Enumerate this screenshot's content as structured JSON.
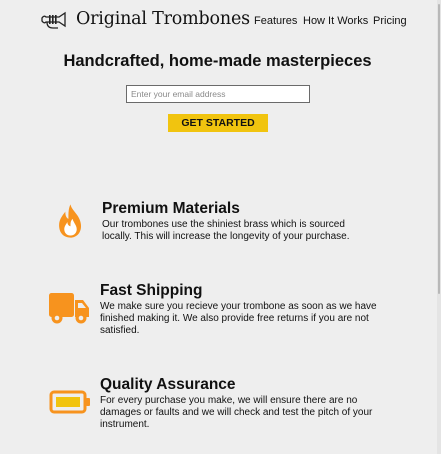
{
  "header": {
    "logo_icon": "trumpet-icon",
    "brand": "Original Trombones",
    "nav": [
      "Features",
      "How It Works",
      "Pricing"
    ]
  },
  "hero": {
    "title": "Handcrafted, home-made masterpieces",
    "email_placeholder": "Enter your email address",
    "cta_label": "GET STARTED"
  },
  "features": [
    {
      "icon": "fire-icon",
      "title": "Premium Materials",
      "description": "Our trombones use the shiniest brass which is sourced locally. This will increase the longevity of your purchase."
    },
    {
      "icon": "truck-icon",
      "title": "Fast Shipping",
      "description": "We make sure you recieve your trombone as soon as we have finished making it. We also provide free returns if you are not satisfied."
    },
    {
      "icon": "battery-icon",
      "title": "Quality Assurance",
      "description": "For every purchase you make, we will ensure there are no damages or faults and we will check and test the pitch of your instrument."
    }
  ],
  "colors": {
    "accent": "#f1c40f",
    "icon_orange": "#f7931e",
    "background": "#eeeeee"
  }
}
